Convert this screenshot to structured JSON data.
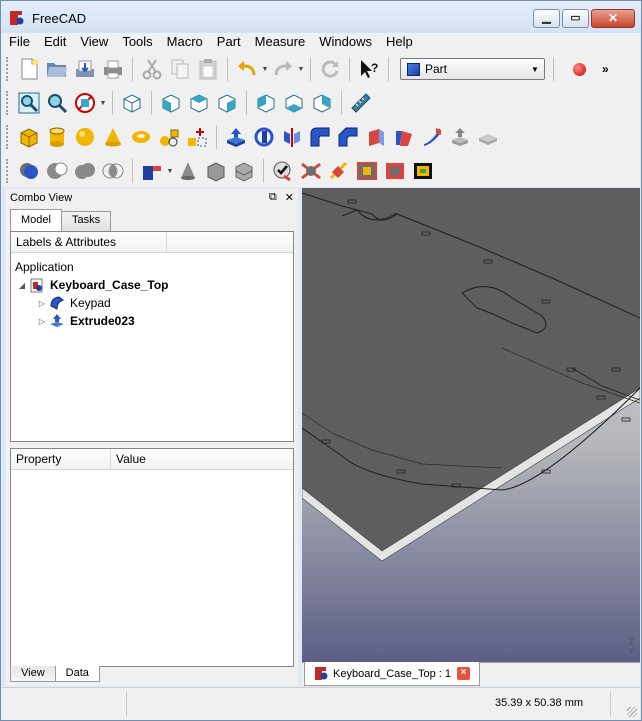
{
  "window": {
    "title": "FreeCAD"
  },
  "menu": [
    "File",
    "Edit",
    "View",
    "Tools",
    "Macro",
    "Part",
    "Measure",
    "Windows",
    "Help"
  ],
  "toolbar": {
    "row1": [
      "new-file-icon",
      "open-file-icon",
      "save-icon",
      "print-icon",
      "cut-icon",
      "copy-icon",
      "paste-icon",
      "undo-icon",
      "redo-icon",
      "refresh-icon",
      "whats-this-icon"
    ],
    "workbench": {
      "label": "Part"
    },
    "row2": [
      "fit-all-icon",
      "fit-selection-icon",
      "draw-style-icon",
      "isometric-view-icon",
      "front-view-icon",
      "top-view-icon",
      "right-view-icon",
      "rear-view-icon",
      "bottom-view-icon",
      "left-view-icon",
      "measure-icon"
    ],
    "row3": [
      "box-icon",
      "cylinder-icon",
      "sphere-icon",
      "cone-icon",
      "torus-icon",
      "primitives-icon",
      "shape-builder-icon",
      "extrude-icon",
      "revolve-icon",
      "mirror-icon",
      "fillet-icon",
      "chamfer-icon",
      "make-face-icon",
      "ruled-surface-icon",
      "loft-icon",
      "sweep-icon",
      "section-icon",
      "cross-sections-icon"
    ],
    "row4": [
      "boolean-icon",
      "cut-shape-icon",
      "fuse-icon",
      "common-icon",
      "join-icon",
      "split-icon",
      "compound-icon",
      "explode-compound-icon",
      "check-geometry-icon",
      "defeaturing-icon",
      "attachment-icon",
      "offset-icon",
      "thickness-icon",
      "projection-icon"
    ]
  },
  "combo_view": {
    "title": "Combo View",
    "tabs": [
      "Model",
      "Tasks"
    ],
    "tree_header": "Labels & Attributes",
    "tree_root": "Application",
    "tree": [
      {
        "label": "Keyboard_Case_Top",
        "bold": true
      },
      {
        "label": "Keypad",
        "bold": false
      },
      {
        "label": "Extrude023",
        "bold": true
      }
    ],
    "property_headers": [
      "Property",
      "Value"
    ],
    "bottom_tabs": [
      "View",
      "Data"
    ]
  },
  "document_tab": {
    "label": "Keyboard_Case_Top : 1"
  },
  "status": {
    "dimensions": "35.39 x 50.38 mm"
  },
  "axis": [
    "Z",
    "Y"
  ],
  "colors": {
    "accent": "#2a55c8",
    "plate_top": "#5e5e5e",
    "plate_edge": "#e4e4e4"
  }
}
